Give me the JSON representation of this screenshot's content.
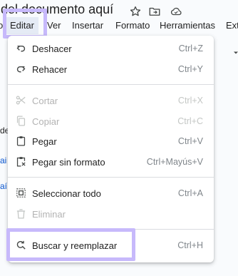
{
  "document": {
    "title": "o del documento aquí"
  },
  "title_icons": [
    "star-icon",
    "move-to-folder-icon",
    "cloud-status-icon"
  ],
  "menubar": {
    "items": [
      {
        "label": "o"
      },
      {
        "label": "Editar"
      },
      {
        "label": "Ver"
      },
      {
        "label": "Insertar"
      },
      {
        "label": "Formato"
      },
      {
        "label": "Herramientas"
      },
      {
        "label": "Ext"
      }
    ]
  },
  "background": {
    "fragments": [
      "de",
      "ai",
      "aí"
    ]
  },
  "edit_menu": {
    "items": [
      {
        "label": "Deshacer",
        "shortcut": "Ctrl+Z",
        "icon": "undo-icon",
        "enabled": true
      },
      {
        "label": "Rehacer",
        "shortcut": "Ctrl+Y",
        "icon": "redo-icon",
        "enabled": true
      },
      {
        "label": "Cortar",
        "shortcut": "Ctrl+X",
        "icon": "scissors-icon",
        "enabled": false
      },
      {
        "label": "Copiar",
        "shortcut": "Ctrl+C",
        "icon": "copy-icon",
        "enabled": false
      },
      {
        "label": "Pegar",
        "shortcut": "Ctrl+V",
        "icon": "clipboard-icon",
        "enabled": true
      },
      {
        "label": "Pegar sin formato",
        "shortcut": "Ctrl+Mayús+V",
        "icon": "paste-plain-icon",
        "enabled": true
      },
      {
        "label": "Seleccionar todo",
        "shortcut": "Ctrl+A",
        "icon": "select-all-icon",
        "enabled": true
      },
      {
        "label": "Eliminar",
        "shortcut": "",
        "icon": "trash-icon",
        "enabled": false
      },
      {
        "label": "Buscar y reemplazar",
        "shortcut": "Ctrl+H",
        "icon": "find-replace-icon",
        "enabled": true
      }
    ]
  },
  "colors": {
    "highlight_outline": "#c7b9fb",
    "active_menu_bg": "#e5ebf5",
    "disabled_text": "#b3b3b3",
    "shortcut_text": "#80868b"
  }
}
